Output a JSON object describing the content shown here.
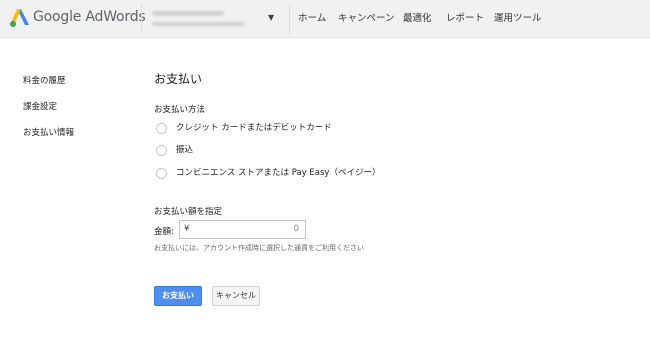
{
  "header": {
    "brand": "Google AdWords",
    "nav": [
      "ホーム",
      "キャンペーン",
      "最適化",
      "レポート",
      "運用ツール"
    ]
  },
  "sidebar": {
    "items": [
      "料金の履歴",
      "課金設定",
      "お支払い情報"
    ]
  },
  "main": {
    "title": "お支払い",
    "payment_method_label": "お支払い方法",
    "payment_methods": [
      "クレジット カードまたはデビットカード",
      "振込",
      "コンビニエンス ストアまたは Pay Easy（ペイジー）"
    ],
    "amount_section_label": "お支払い額を指定",
    "amount_label": "金額:",
    "currency_symbol": "¥",
    "amount_value": "0",
    "note": "お支払いには、アカウント作成時に選択した通貨をご利用ください",
    "submit_label": "お支払い",
    "cancel_label": "キャンセル"
  },
  "colors": {
    "primary_button": "#4d8ef0",
    "topbar": "#f1f1f1"
  }
}
